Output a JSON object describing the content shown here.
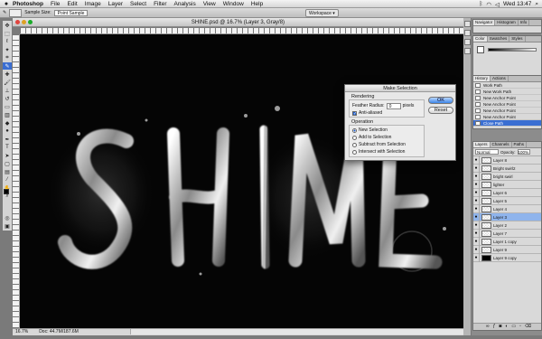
{
  "menubar": {
    "apple": "",
    "app_name": "Photoshop",
    "items": [
      "File",
      "Edit",
      "Image",
      "Layer",
      "Select",
      "Filter",
      "Analysis",
      "View",
      "Window",
      "Help"
    ],
    "clock": "Wed 13:47"
  },
  "options_bar": {
    "sample_size_label": "Sample Size:",
    "sample_size_value": "Point Sample",
    "workspace": "Workspace ▾"
  },
  "document": {
    "title": "SHINE.psd @ 16.7% (Layer 3, Gray/8)",
    "zoom": "16.7%",
    "doc_info": "Doc: 44.7M/187.6M",
    "canvas_text": "SHINE"
  },
  "dialog": {
    "title": "Make Selection",
    "rendering_label": "Rendering",
    "feather_label": "Feather Radius:",
    "feather_value": "0",
    "feather_unit": "pixels",
    "anti_aliased": "Anti-aliased",
    "operation_label": "Operation",
    "operations": [
      "New Selection",
      "Add to Selection",
      "Subtract from Selection",
      "Intersect with Selection"
    ],
    "ok": "OK",
    "reset": "Reset"
  },
  "panels": {
    "navigator_tabs": [
      "Navigator",
      "Histogram",
      "Info"
    ],
    "color_tabs": [
      "Color",
      "Swatches",
      "Styles"
    ],
    "history_tabs": [
      "History",
      "Actions"
    ],
    "history_items": [
      "Work Path",
      "New Work Path",
      "New Anchor Point",
      "New Anchor Point",
      "New Anchor Point",
      "New Anchor Point",
      "Close Path"
    ],
    "layers_tabs": [
      "Layers",
      "Channels",
      "Paths"
    ],
    "blend_mode": "Normal",
    "opacity_label": "Opacity:",
    "opacity_value": "100%",
    "layers": [
      {
        "name": "Layer 8"
      },
      {
        "name": "Bright swirl2"
      },
      {
        "name": "bright swirl"
      },
      {
        "name": "lighter"
      },
      {
        "name": "Layer 6"
      },
      {
        "name": "Layer 5"
      },
      {
        "name": "Layer 4"
      },
      {
        "name": "Layer 3"
      },
      {
        "name": "Layer 2"
      },
      {
        "name": "Layer 7"
      },
      {
        "name": "Layer 1 copy"
      },
      {
        "name": "Layer 9"
      },
      {
        "name": "Layer 9 copy"
      }
    ]
  }
}
